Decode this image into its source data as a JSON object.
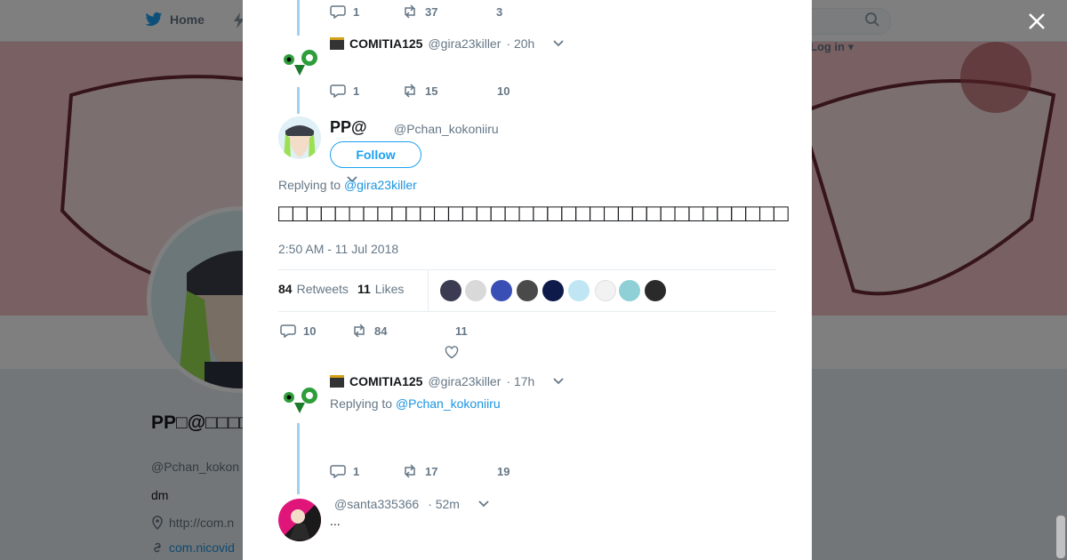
{
  "nav": {
    "home_label": "Home",
    "login_label": "Log in ▾"
  },
  "profile": {
    "name": "PP□@□□□□□□□",
    "handle": "@Pchan_kokon",
    "bio": "dm",
    "location": "http://com.n",
    "url": "com.nicovid"
  },
  "thread": {
    "top_actions": {
      "replies": "1",
      "retweets": "37",
      "likes": "3"
    },
    "parent": {
      "name": "COMITIA125",
      "handle": "@gira23killer",
      "time": "· 20h",
      "actions": {
        "replies": "1",
        "retweets": "15",
        "likes": "10"
      }
    },
    "focus": {
      "name": "PP@",
      "handle": "@Pchan_kokoniiru",
      "follow_label": "Follow",
      "replying_prefix": "Replying to",
      "replying_to": "@gira23killer",
      "text": "□□□□□□□□□□□□□□□□□□□□□□□□□□□□□□□□□□□□",
      "timestamp": "2:50 AM - 11 Jul 2018",
      "retweets_count": "84",
      "retweets_label": "Retweets",
      "likes_count": "11",
      "likes_label": "Likes",
      "actions": {
        "replies": "10",
        "retweets": "84",
        "likes": "11"
      }
    },
    "reply1": {
      "name": "COMITIA125",
      "handle": "@gira23killer",
      "time": "· 17h",
      "replying_prefix": "Replying to",
      "replying_to": "@Pchan_kokoniiru",
      "actions": {
        "replies": "1",
        "retweets": "17",
        "likes": "19"
      }
    },
    "reply2": {
      "handle": "@santa335366",
      "time": "· 52m",
      "text": "..."
    }
  },
  "colors": {
    "accent": "#1da1f2",
    "link": "#1b95e0",
    "muted": "#657786",
    "thread_line": "#a3cfee"
  }
}
